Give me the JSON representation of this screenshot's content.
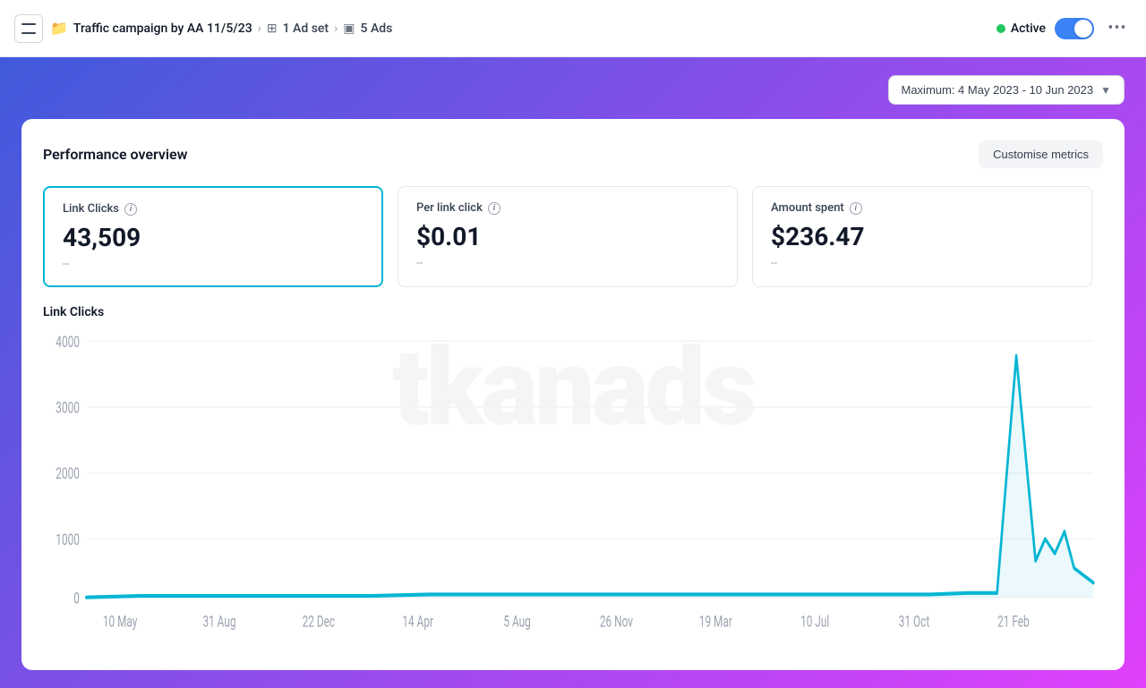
{
  "topbar": {
    "campaign_name": "Traffic campaign by AA 11/5/23",
    "adset_label": "1 Ad set",
    "ads_label": "5 Ads",
    "status_label": "Active",
    "toggle_state": true,
    "more_icon": "•••"
  },
  "date_range": {
    "label": "Maximum: 4 May 2023 - 10 Jun 2023",
    "chevron": "▼"
  },
  "performance": {
    "title": "Performance overview",
    "customise_label": "Customise metrics",
    "watermark": "tkanads",
    "metrics": [
      {
        "label": "Link Clicks",
        "value": "43,509",
        "sub": "--",
        "active": true
      },
      {
        "label": "Per link click",
        "value": "$0.01",
        "sub": "--",
        "active": false
      },
      {
        "label": "Amount spent",
        "value": "$236.47",
        "sub": "--",
        "active": false
      }
    ],
    "chart": {
      "label": "Link Clicks",
      "y_labels": [
        "0",
        "1000",
        "2000",
        "3000",
        "4000"
      ],
      "x_labels": [
        "10 May",
        "31 Aug",
        "22 Dec",
        "14 Apr",
        "5 Aug",
        "26 Nov",
        "19 Mar",
        "10 Jul",
        "31 Oct",
        "21 Feb"
      ]
    }
  }
}
